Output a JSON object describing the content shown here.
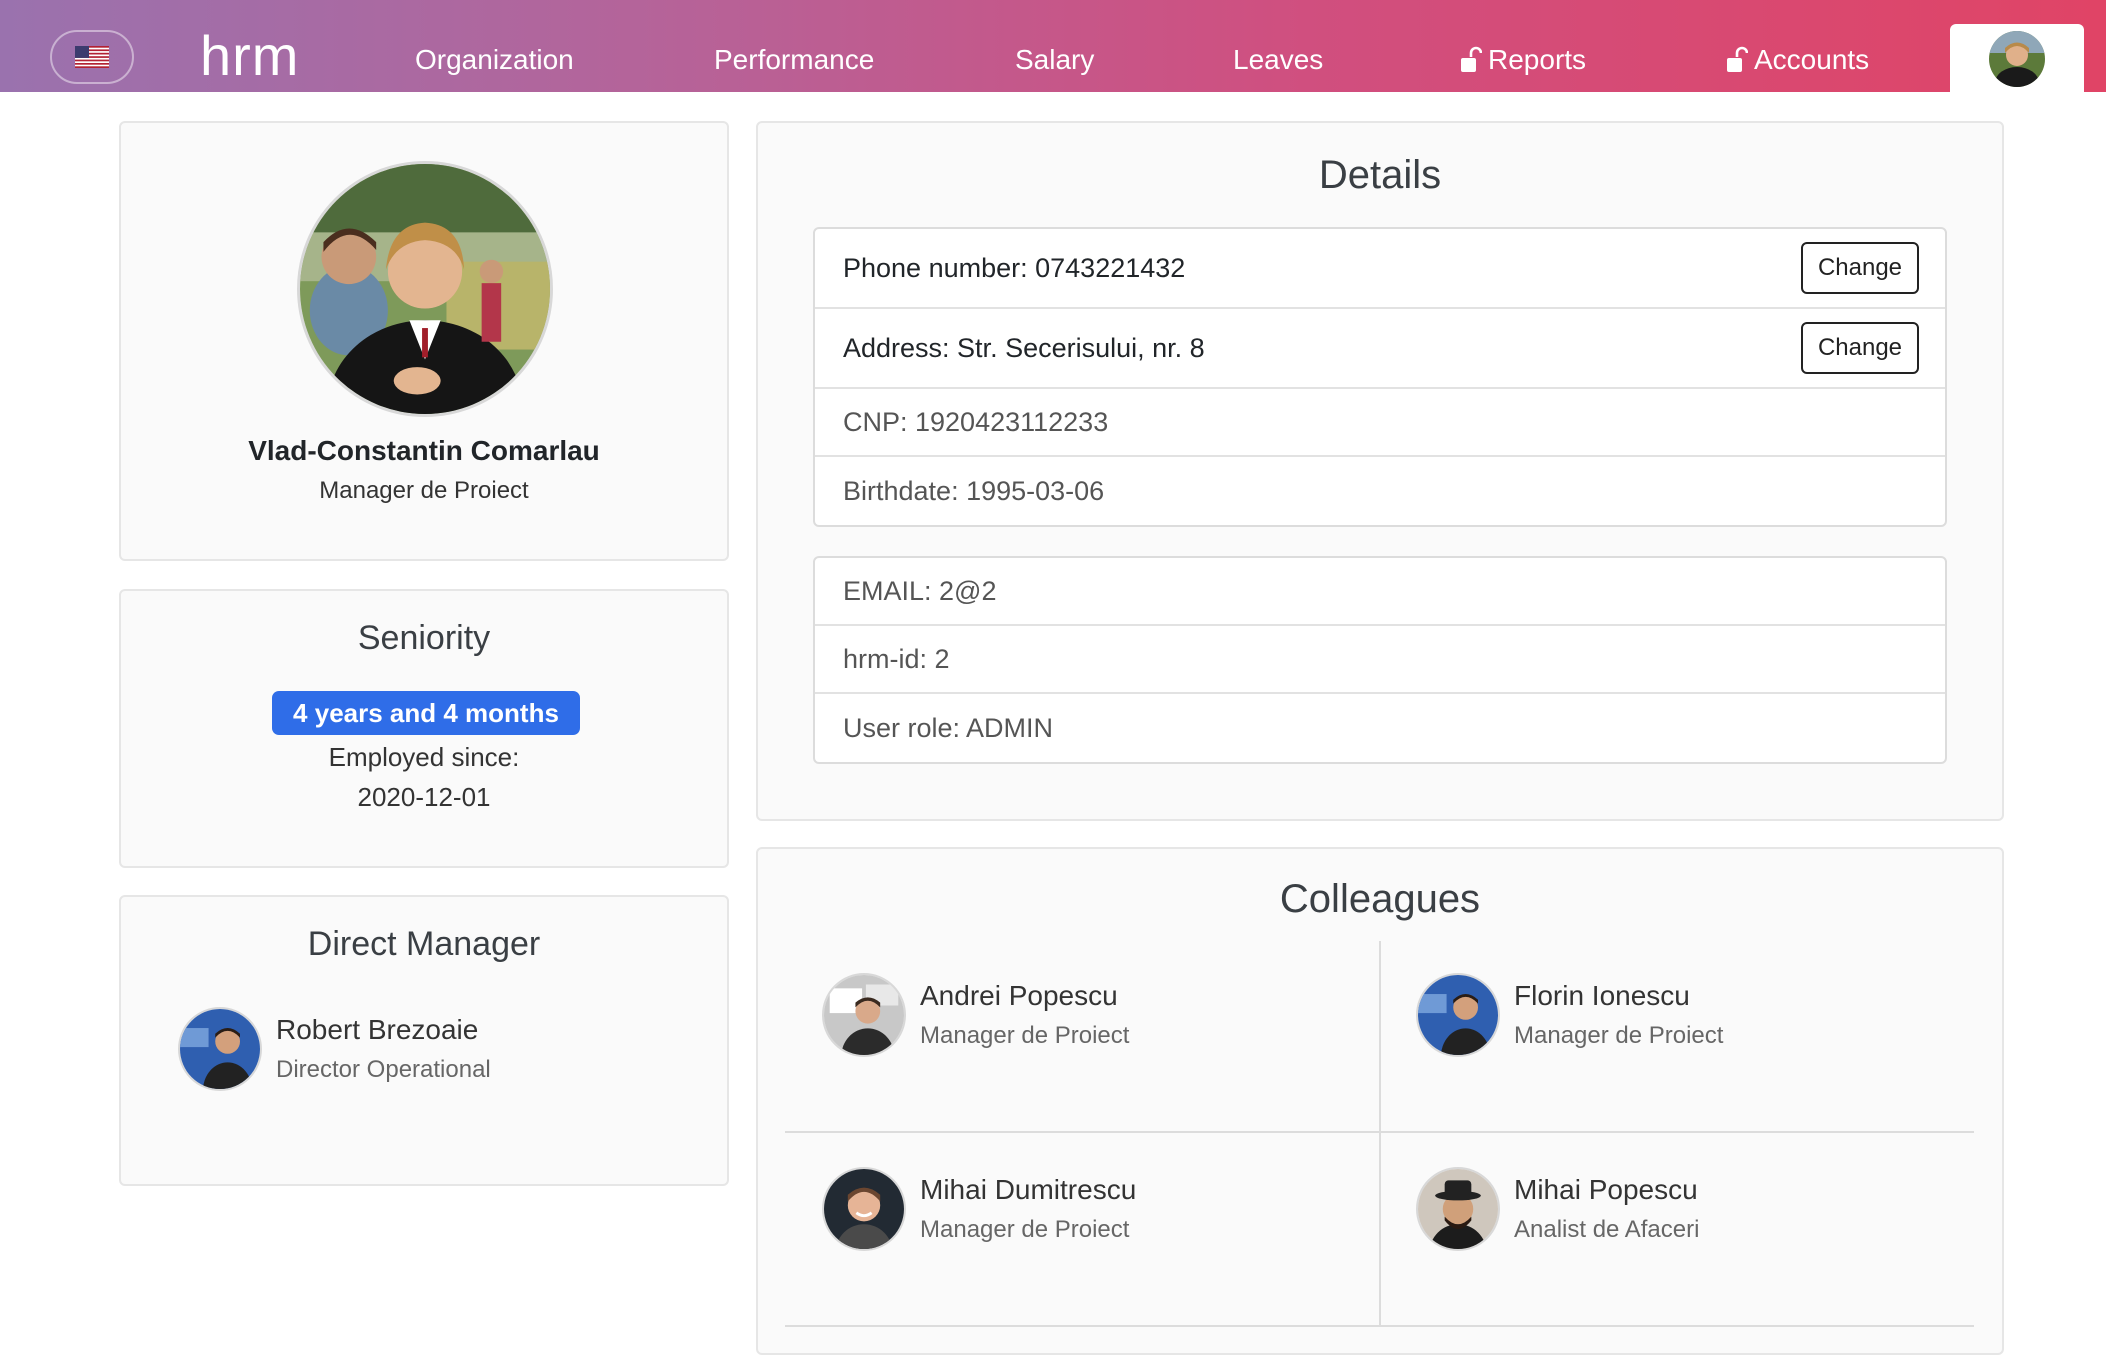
{
  "nav": {
    "language_flag": "us-flag-icon",
    "brand": "hrm",
    "links": [
      {
        "label": "Organization",
        "locked": false
      },
      {
        "label": "Performance",
        "locked": false
      },
      {
        "label": "Salary",
        "locked": false
      },
      {
        "label": "Leaves",
        "locked": false
      },
      {
        "label": "Reports",
        "locked": true
      },
      {
        "label": "Accounts",
        "locked": true
      }
    ],
    "gradient_colors": [
      "#9a72ae",
      "#e04466"
    ]
  },
  "profile": {
    "name": "Vlad-Constantin Comarlau",
    "role": "Manager de Proiect"
  },
  "seniority": {
    "title": "Seniority",
    "badge": "4 years and 4 months",
    "employed_label": "Employed since:",
    "employed_date": "2020-12-01",
    "badge_color": "#2f6de8"
  },
  "manager": {
    "title": "Direct Manager",
    "name": "Robert Brezoaie",
    "role": "Director Operational"
  },
  "details": {
    "title": "Details",
    "change_label": "Change",
    "phone": "Phone number: 0743221432",
    "address": "Address: Str. Secerisului, nr. 8",
    "cnp": "CNP: 1920423112233",
    "birthdate": "Birthdate: 1995-03-06",
    "email": "EMAIL: 2@2",
    "hrm_id": "hrm-id: 2",
    "user_role": "User role: ADMIN"
  },
  "colleagues": {
    "title": "Colleagues",
    "items": [
      {
        "name": "Andrei Popescu",
        "role": "Manager de Proiect"
      },
      {
        "name": "Florin Ionescu",
        "role": "Manager de Proiect"
      },
      {
        "name": "Mihai Dumitrescu",
        "role": "Manager de Proiect"
      },
      {
        "name": "Mihai Popescu",
        "role": "Analist de Afaceri"
      }
    ]
  }
}
